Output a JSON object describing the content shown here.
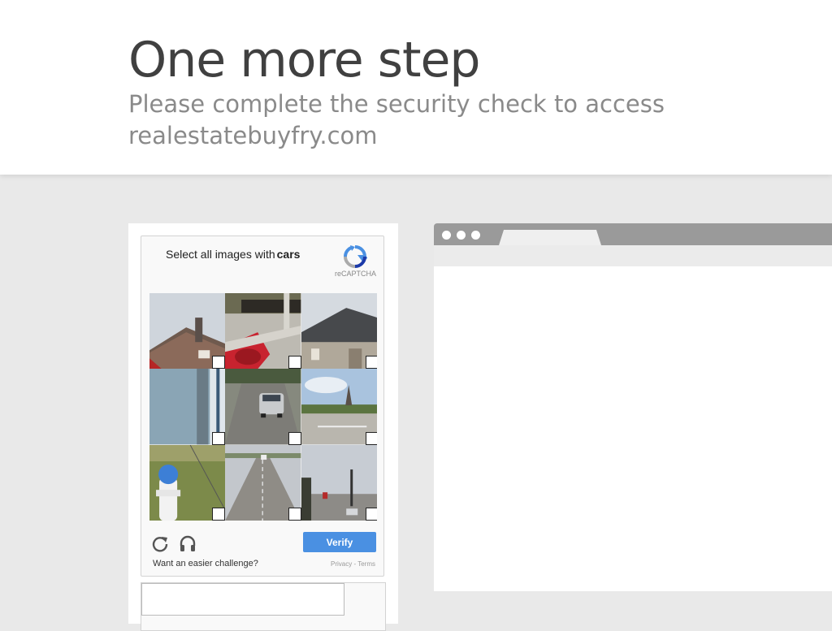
{
  "header": {
    "title": "One more step",
    "subtitle": "Please complete the security check to access realestatebuyfry.com"
  },
  "captcha": {
    "prompt_prefix": "Select all images with",
    "prompt_target": "cars",
    "brand_label": "reCAPTCHA",
    "tiles": [
      {
        "scene": "house roof with red car corner"
      },
      {
        "scene": "red car on sidewalk"
      },
      {
        "scene": "house with gray roof"
      },
      {
        "scene": "pole and sky"
      },
      {
        "scene": "silver car on road"
      },
      {
        "scene": "road with church spire"
      },
      {
        "scene": "fire hydrant on grass"
      },
      {
        "scene": "highway road"
      },
      {
        "scene": "street with traffic lights"
      }
    ],
    "verify_label": "Verify",
    "easier_label": "Want an easier challenge?",
    "privacy_label": "Privacy",
    "terms_label": "Terms",
    "legal_separator": " - ",
    "icons": {
      "reload": "reload-icon",
      "audio": "headphones-icon",
      "logo": "recaptcha-logo-icon"
    },
    "accent_color": "#4a90e2"
  },
  "browser_illustration": {
    "window_dots": 3
  }
}
